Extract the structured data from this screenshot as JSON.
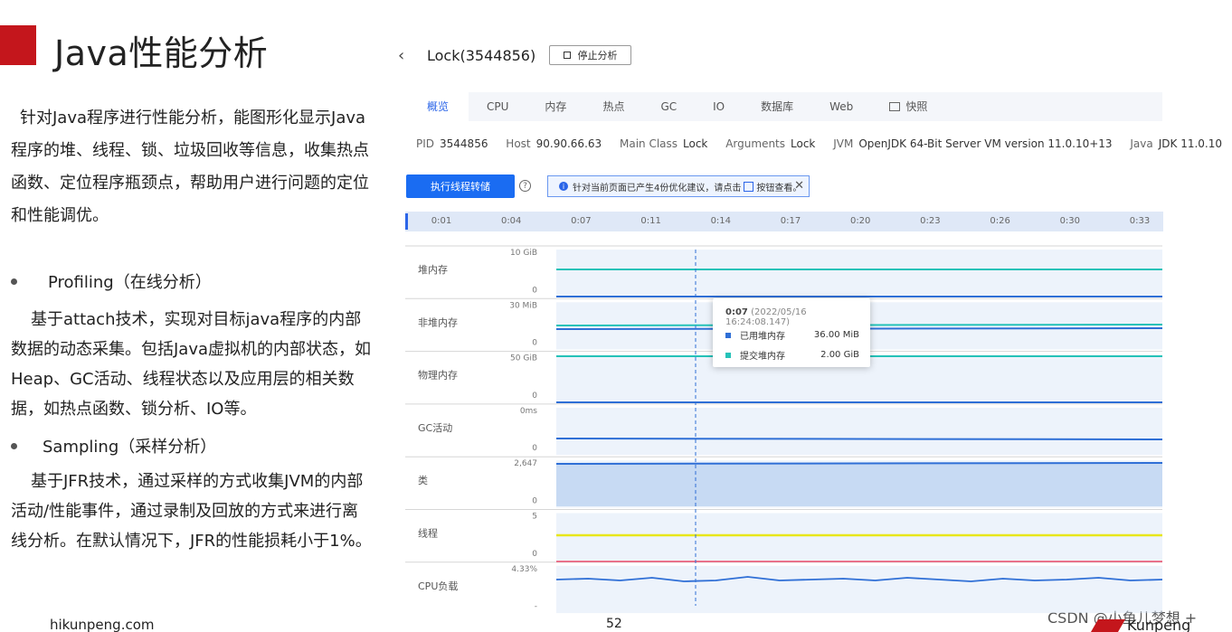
{
  "slide": {
    "title": "Java性能分析",
    "intro": "针对Java程序进行性能分析，能图形化显示Java程序的堆、线程、锁、垃圾回收等信息，收集热点函数、定位程序瓶颈点，帮助用户进行问题的定位和性能调优。",
    "bullets": [
      {
        "label": "Profiling（在线分析）",
        "text": "基于attach技术，实现对目标java程序的内部数据的动态采集。包括Java虚拟机的内部状态，如Heap、GC活动、线程状态以及应用层的相关数据，如热点函数、锁分析、IO等。"
      },
      {
        "label": "Sampling（采样分析）",
        "text": "基于JFR技术，通过采样的方式收集JVM的内部活动/性能事件，通过录制及回放的方式来进行离线分析。在默认情况下，JFR的性能损耗小于1%。"
      }
    ],
    "footer_url": "hikunpeng.com",
    "page_number": "52",
    "watermark": "CSDN @小鱼儿梦想 +",
    "logo_text": "Kunpeng",
    "accent": "#c4161c"
  },
  "app": {
    "header": {
      "back_icon": "chevron-left",
      "title": "Lock(3544856)",
      "stop_button": "停止分析"
    },
    "tabs": [
      "概览",
      "CPU",
      "内存",
      "热点",
      "GC",
      "IO",
      "数据库",
      "Web",
      "快照"
    ],
    "active_tab": "概览",
    "info": [
      {
        "key": "PID",
        "value": "3544856"
      },
      {
        "key": "Host",
        "value": "90.90.66.63"
      },
      {
        "key": "Main Class",
        "value": "Lock"
      },
      {
        "key": "Arguments",
        "value": "Lock"
      },
      {
        "key": "JVM",
        "value": "OpenJDK 64-Bit Server VM version 11.0.10+13"
      },
      {
        "key": "Java",
        "value": "JDK 11.0.10"
      }
    ],
    "dump_button": "执行线程转储",
    "notice": {
      "text_before": "针对当前页面已产生4份优化建议，请点击",
      "text_after": "按钮查看。"
    },
    "timeline_ticks": [
      "0:01",
      "0:04",
      "0:07",
      "0:11",
      "0:14",
      "0:17",
      "0:20",
      "0:23",
      "0:26",
      "0:30",
      "0:33"
    ],
    "colors": {
      "primary": "#1a6cf2",
      "line_blue": "#2f6fd6",
      "line_teal": "#25c2b8",
      "line_yellow": "#e8e61a",
      "line_red": "#e84a6a",
      "fill": "#d6e4f7"
    }
  },
  "chart_data": {
    "type": "line",
    "x": [
      "0:01",
      "0:04",
      "0:07",
      "0:11",
      "0:14",
      "0:17",
      "0:20",
      "0:23",
      "0:26",
      "0:30",
      "0:33"
    ],
    "panels": [
      {
        "label": "堆内存",
        "ymax_label": "10 GiB",
        "ymin_label": "0"
      },
      {
        "label": "非堆内存",
        "ymax_label": "30 MiB",
        "ymin_label": "0"
      },
      {
        "label": "物理内存",
        "ymax_label": "50 GiB",
        "ymin_label": "0"
      },
      {
        "label": "GC活动",
        "ymax_label": "0ms",
        "ymin_label": "0"
      },
      {
        "label": "类",
        "ymax_label": "2,647",
        "ymin_label": "0"
      },
      {
        "label": "线程",
        "ymax_label": "5",
        "ymin_label": "0"
      },
      {
        "label": "CPU负载",
        "ymax_label": "4.33%",
        "ymin_label": "-"
      }
    ],
    "cpu_load_series": [
      3.1,
      3.2,
      3.0,
      3.3,
      2.9,
      3.0,
      3.4,
      3.0,
      3.1,
      3.2,
      3.0,
      3.3,
      3.1,
      2.9,
      3.2,
      3.0,
      3.1,
      3.3,
      3.0,
      3.1
    ],
    "tooltip": {
      "time": "0:07",
      "timestamp": "(2022/05/16 16:24:08.147)",
      "rows": [
        {
          "name": "已用堆内存",
          "value": "36.00 MiB",
          "color": "#2f6fd6"
        },
        {
          "name": "提交堆内存",
          "value": "2.00 GiB",
          "color": "#25c2b8"
        }
      ]
    }
  }
}
